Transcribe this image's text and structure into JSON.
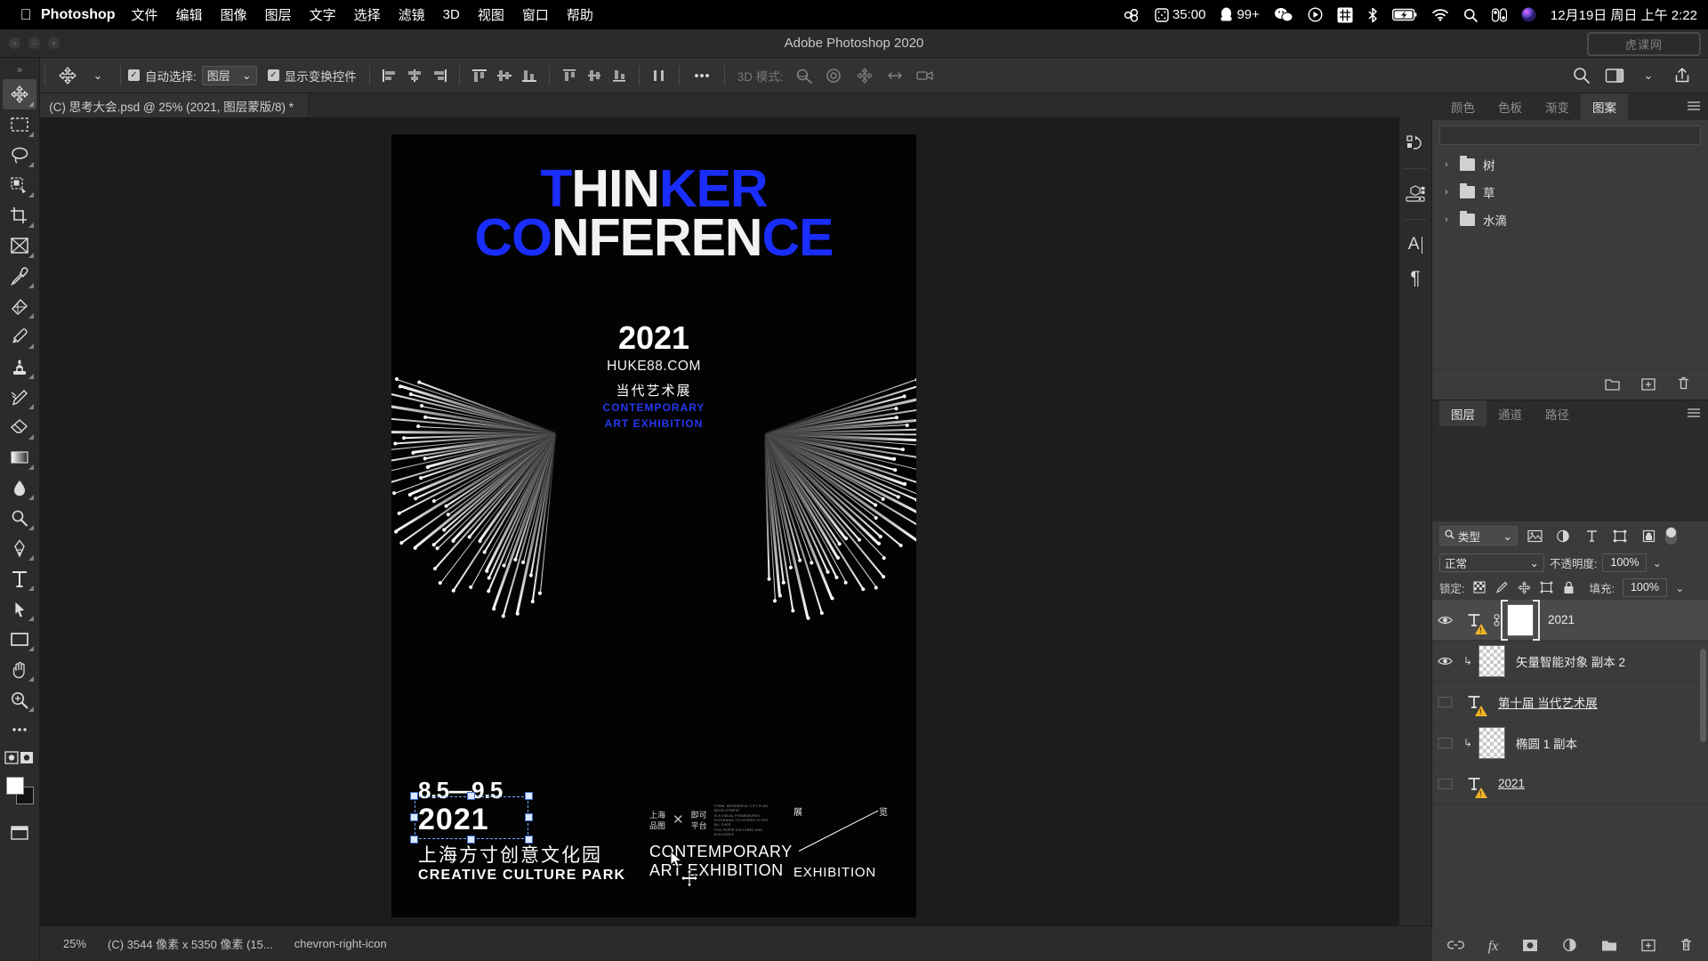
{
  "macbar": {
    "apple_icon": "apple-logo",
    "app_name": "Photoshop",
    "menus": [
      "文件",
      "编辑",
      "图像",
      "图层",
      "文字",
      "选择",
      "滤镜",
      "3D",
      "视图",
      "窗口",
      "帮助"
    ],
    "status_items": [
      {
        "name": "cloud-sync-icon",
        "label": ""
      },
      {
        "name": "timer-icon",
        "label": "35:00"
      },
      {
        "name": "qq-icon",
        "label": "99+"
      },
      {
        "name": "wechat-icon",
        "label": ""
      },
      {
        "name": "media-play-icon",
        "label": ""
      },
      {
        "name": "input-method-icon",
        "label": ""
      },
      {
        "name": "bluetooth-icon",
        "label": ""
      },
      {
        "name": "battery-charging-icon",
        "label": ""
      },
      {
        "name": "wifi-icon",
        "label": ""
      },
      {
        "name": "spotlight-search-icon",
        "label": ""
      },
      {
        "name": "control-center-icon",
        "label": ""
      },
      {
        "name": "siri-icon",
        "label": ""
      }
    ],
    "clock": "12月19日 周日 上午 2:22"
  },
  "titlebar": {
    "title": "Adobe Photoshop 2020",
    "watermark": "虎课网"
  },
  "options_bar": {
    "home_icon": "home-icon",
    "tool_icon": "move-tool-icon",
    "auto_select_checked": true,
    "auto_select_label": "自动选择:",
    "auto_select_value": "图层",
    "show_transform_checked": true,
    "show_transform_label": "显示变换控件",
    "align_icons": [
      "align-left-edges-icon",
      "align-horizontal-centers-icon",
      "align-right-edges-icon",
      "align-top-edges-icon",
      "align-vertical-centers-icon",
      "align-bottom-edges-icon",
      "distribute-top-icon",
      "distribute-vertical-center-icon",
      "distribute-bottom-icon",
      "distribute-spacing-icon"
    ],
    "more_icon": "more-options-icon",
    "mode_3d_label": "3D 模式:",
    "mode_3d_icons": [
      "orbit-3d-icon",
      "roll-3d-icon",
      "pan-3d-icon",
      "slide-3d-icon",
      "camera-3d-icon"
    ],
    "right_icons": [
      "search-icon",
      "workspace-icon",
      "chevron-down-icon",
      "share-icon"
    ]
  },
  "tabbar": {
    "collapse_left_icon": "collapse-left-icon",
    "document_tab": "(C) 思考大会.psd @ 25% (2021, 图层蒙版/8) *",
    "close_icon": "close-icon",
    "collapse_right_icon": "collapse-right-icon"
  },
  "toolbar": {
    "tools": [
      {
        "name": "move-tool",
        "icon": "move-arrows-icon",
        "active": true
      },
      {
        "name": "rectangular-marquee-tool",
        "icon": "marquee-rect-icon",
        "active": false
      },
      {
        "name": "lasso-tool",
        "icon": "lasso-icon",
        "active": false
      },
      {
        "name": "quick-selection-tool",
        "icon": "quick-select-icon",
        "active": false
      },
      {
        "name": "crop-tool",
        "icon": "crop-icon",
        "active": false
      },
      {
        "name": "frame-tool",
        "icon": "frame-icon",
        "active": false
      },
      {
        "name": "eyedropper-tool",
        "icon": "eyedropper-icon",
        "active": false
      },
      {
        "name": "spot-healing-brush-tool",
        "icon": "healing-brush-icon",
        "active": false
      },
      {
        "name": "brush-tool",
        "icon": "brush-icon",
        "active": false
      },
      {
        "name": "clone-stamp-tool",
        "icon": "clone-stamp-icon",
        "active": false
      },
      {
        "name": "history-brush-tool",
        "icon": "history-brush-icon",
        "active": false
      },
      {
        "name": "eraser-tool",
        "icon": "eraser-icon",
        "active": false
      },
      {
        "name": "gradient-tool",
        "icon": "gradient-icon",
        "active": false
      },
      {
        "name": "blur-tool",
        "icon": "blur-drop-icon",
        "active": false
      },
      {
        "name": "dodge-tool",
        "icon": "dodge-icon",
        "active": false
      },
      {
        "name": "pen-tool",
        "icon": "pen-icon",
        "active": false
      },
      {
        "name": "type-tool",
        "icon": "type-t-icon",
        "active": false
      },
      {
        "name": "path-selection-tool",
        "icon": "path-select-arrow-icon",
        "active": false
      },
      {
        "name": "rectangle-tool",
        "icon": "rectangle-shape-icon",
        "active": false
      },
      {
        "name": "hand-tool",
        "icon": "hand-icon",
        "active": false
      },
      {
        "name": "zoom-tool",
        "icon": "zoom-magnifier-icon",
        "active": false
      },
      {
        "name": "edit-toolbar",
        "icon": "ellipsis-icon",
        "active": false
      },
      {
        "name": "quick-mask-toggle",
        "icon": "quick-mask-icon",
        "active": false
      },
      {
        "name": "screen-mode",
        "icon": "screen-mode-icon",
        "active": false
      }
    ]
  },
  "canvas": {
    "poster": {
      "title_line1_parts": [
        {
          "text": "T",
          "white": false
        },
        {
          "text": "HIN",
          "white": true
        },
        {
          "text": "KER",
          "white": false
        }
      ],
      "title_line2_parts": [
        {
          "text": "CO",
          "white": false
        },
        {
          "text": "NFEREN",
          "white": true
        },
        {
          "text": "CE",
          "white": false
        }
      ],
      "title_line1": "THINKER",
      "title_line2": "CONFERENCE",
      "year": "2021",
      "url": "HUKE88.COM",
      "subtitle_cn": "当代艺术展",
      "subtitle_en_1": "CONTEMPORARY",
      "subtitle_en_2": "ART EXHIBITION",
      "date_range": "8.5—9.5",
      "bottom_year": "2021",
      "venue_cn": "上海方寸创意文化园",
      "venue_en": "CREATIVE CULTURE PARK",
      "org_left_1": "上海",
      "org_left_2": "品图",
      "org_cross": "✕",
      "org_right_1": "即可",
      "org_right_2": "平台",
      "micro_text": "THINK, WONDERFUL CITY PLAN DEVELOPMENT\nIS A VISUAL FRAMEWORKS\nEXTENDING TO OTHERS CITIES ALL OVER\nTHIS PAPER EXPLORES AND DISCUSSES",
      "contemporary_1": "CONTEMPORARY",
      "contemporary_2": "ART EXHIBITION",
      "zhan_char": "展",
      "lan_char": "览",
      "exhibition": "EXHIBITION"
    },
    "accent_blue": "#1a2dff"
  },
  "statusbar": {
    "zoom": "25%",
    "doc_info": "(C) 3544 像素 x 5350 像素 (15...",
    "expand_icon": "chevron-right-icon"
  },
  "dock_rail": {
    "items": [
      {
        "name": "history-actions-icon"
      },
      {
        "name": "3d-properties-icon"
      },
      {
        "name": "character-panel-icon",
        "label": "A"
      },
      {
        "name": "paragraph-panel-icon",
        "label": "¶"
      }
    ]
  },
  "patterns_panel": {
    "tabs": [
      {
        "label": "颜色",
        "active": false
      },
      {
        "label": "色板",
        "active": false
      },
      {
        "label": "渐变",
        "active": false
      },
      {
        "label": "图案",
        "active": true
      }
    ],
    "menu_icon": "panel-menu-icon",
    "groups": [
      {
        "label": "树",
        "icon": "folder-icon",
        "chevron": "›"
      },
      {
        "label": "草",
        "icon": "folder-icon",
        "chevron": "›"
      },
      {
        "label": "水滴",
        "icon": "folder-icon",
        "chevron": "›"
      }
    ],
    "bottom_icons": [
      "new-folder-icon",
      "new-pattern-icon",
      "delete-icon"
    ]
  },
  "layers_panel": {
    "tabs": [
      {
        "label": "图层",
        "active": true
      },
      {
        "label": "通道",
        "active": false
      },
      {
        "label": "路径",
        "active": false
      }
    ],
    "menu_icon": "panel-menu-icon",
    "filter": {
      "search_icon": "search-icon",
      "type_label": "类型",
      "chevron": "⌄",
      "filter_icons": [
        "filter-pixel-icon",
        "filter-adjustment-icon",
        "filter-type-icon",
        "filter-shape-icon",
        "filter-smart-object-icon"
      ],
      "toggle_name": "filter-toggle"
    },
    "blend_mode": "正常",
    "opacity_label": "不透明度:",
    "opacity_value": "100%",
    "lock_label": "锁定:",
    "lock_icons": [
      "lock-transparent-pixels-icon",
      "lock-image-pixels-icon",
      "lock-position-icon",
      "lock-artboard-nesting-icon",
      "lock-all-icon"
    ],
    "fill_label": "填充:",
    "fill_value": "100%",
    "layers": [
      {
        "name": "2021",
        "visible": true,
        "selected": true,
        "kind": "type-with-mask",
        "linked": true,
        "underline": false,
        "clipped": false
      },
      {
        "name": "矢量智能对象 副本 2",
        "visible": true,
        "selected": false,
        "kind": "smart-object",
        "linked": false,
        "underline": false,
        "clipped": true
      },
      {
        "name": "第十届 当代艺术展",
        "visible": false,
        "selected": false,
        "kind": "type",
        "linked": false,
        "underline": true,
        "clipped": false
      },
      {
        "name": "椭圆 1 副本",
        "visible": false,
        "selected": false,
        "kind": "shape",
        "linked": false,
        "underline": false,
        "clipped": true
      },
      {
        "name": "2021",
        "visible": false,
        "selected": false,
        "kind": "type",
        "linked": false,
        "underline": true,
        "clipped": false
      }
    ],
    "bottom_icons": [
      "link-layers-icon",
      "layer-styles-fx-icon",
      "add-layer-mask-icon",
      "new-adjustment-layer-icon",
      "new-group-icon",
      "new-layer-icon",
      "delete-layer-icon"
    ]
  }
}
